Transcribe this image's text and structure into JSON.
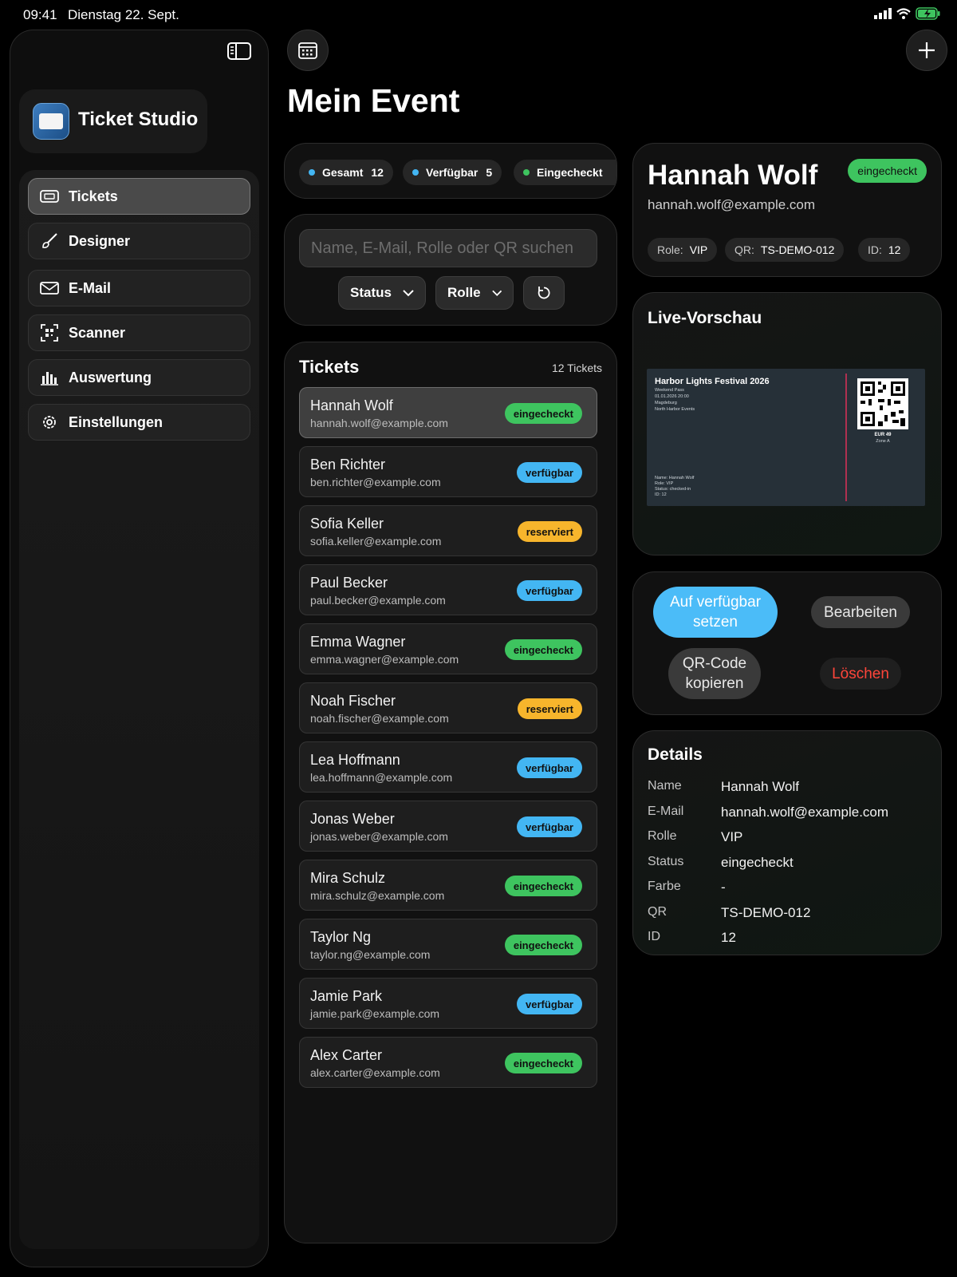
{
  "status_bar": {
    "time": "09:41",
    "date": "Dienstag 22. Sept."
  },
  "sidebar": {
    "app_name": "Ticket Studio",
    "items": [
      {
        "label": "Tickets",
        "icon": "ticket-icon",
        "active": true
      },
      {
        "label": "Designer",
        "icon": "brush-icon"
      },
      {
        "label": "E-Mail",
        "icon": "envelope-icon"
      },
      {
        "label": "Scanner",
        "icon": "qr-scan-icon"
      },
      {
        "label": "Auswertung",
        "icon": "bar-chart-icon"
      },
      {
        "label": "Einstellungen",
        "icon": "gear-icon"
      }
    ]
  },
  "header": {
    "title": "Mein Event"
  },
  "stats": {
    "total_label": "Gesamt",
    "total_value": "12",
    "available_label": "Verfügbar",
    "available_value": "5",
    "checked_label": "Eingecheckt"
  },
  "filter": {
    "search_placeholder": "Name, E-Mail, Rolle oder QR suchen",
    "status_label": "Status",
    "role_label": "Rolle"
  },
  "tickets": {
    "title": "Tickets",
    "count": "12 Tickets",
    "rows": [
      {
        "name": "Hannah Wolf",
        "email": "hannah.wolf@example.com",
        "status": "eingecheckt"
      },
      {
        "name": "Ben Richter",
        "email": "ben.richter@example.com",
        "status": "verfügbar"
      },
      {
        "name": "Sofia Keller",
        "email": "sofia.keller@example.com",
        "status": "reserviert"
      },
      {
        "name": "Paul Becker",
        "email": "paul.becker@example.com",
        "status": "verfügbar"
      },
      {
        "name": "Emma Wagner",
        "email": "emma.wagner@example.com",
        "status": "eingecheckt"
      },
      {
        "name": "Noah Fischer",
        "email": "noah.fischer@example.com",
        "status": "reserviert"
      },
      {
        "name": "Lea Hoffmann",
        "email": "lea.hoffmann@example.com",
        "status": "verfügbar"
      },
      {
        "name": "Jonas Weber",
        "email": "jonas.weber@example.com",
        "status": "verfügbar"
      },
      {
        "name": "Mira Schulz",
        "email": "mira.schulz@example.com",
        "status": "eingecheckt"
      },
      {
        "name": "Taylor Ng",
        "email": "taylor.ng@example.com",
        "status": "eingecheckt"
      },
      {
        "name": "Jamie Park",
        "email": "jamie.park@example.com",
        "status": "verfügbar"
      },
      {
        "name": "Alex Carter",
        "email": "alex.carter@example.com",
        "status": "eingecheckt"
      }
    ]
  },
  "selected": {
    "name": "Hannah Wolf",
    "email": "hannah.wolf@example.com",
    "status": "eingecheckt",
    "role_key": "Role:",
    "role": "VIP",
    "qr_key": "QR:",
    "qr": "TS-DEMO-012",
    "id_key": "ID:",
    "id": "12"
  },
  "preview": {
    "title": "Live-Vorschau",
    "event": "Harbor Lights Festival 2026",
    "pass": "Weekend Pass",
    "datetime": "01.01.2026 20:00",
    "city": "Magdeburg",
    "organizer": "North Harbor Events",
    "attendee_name": "Name: Hannah Wolf",
    "attendee_role": "Role: VIP",
    "attendee_status": "Status: checked-in",
    "attendee_id": "ID: 12",
    "price": "EUR 49",
    "zone": "Zone A"
  },
  "actions": {
    "set_available": "Auf verfügbar setzen",
    "edit": "Bearbeiten",
    "copy_qr": "QR-Code kopieren",
    "delete": "Löschen"
  },
  "details": {
    "title": "Details",
    "rows": [
      {
        "key": "Name",
        "value": "Hannah Wolf"
      },
      {
        "key": "E-Mail",
        "value": "hannah.wolf@example.com"
      },
      {
        "key": "Rolle",
        "value": "VIP"
      },
      {
        "key": "Status",
        "value": "eingecheckt"
      },
      {
        "key": "Farbe",
        "value": "-"
      },
      {
        "key": "QR",
        "value": "TS-DEMO-012"
      },
      {
        "key": "ID",
        "value": "12"
      }
    ]
  },
  "colors": {
    "eingecheckt": "#3ec45f",
    "verfügbar": "#43b6f3",
    "reserviert": "#f7b52c",
    "delete": "#ff453a",
    "primary_button": "#4bbcf8"
  }
}
